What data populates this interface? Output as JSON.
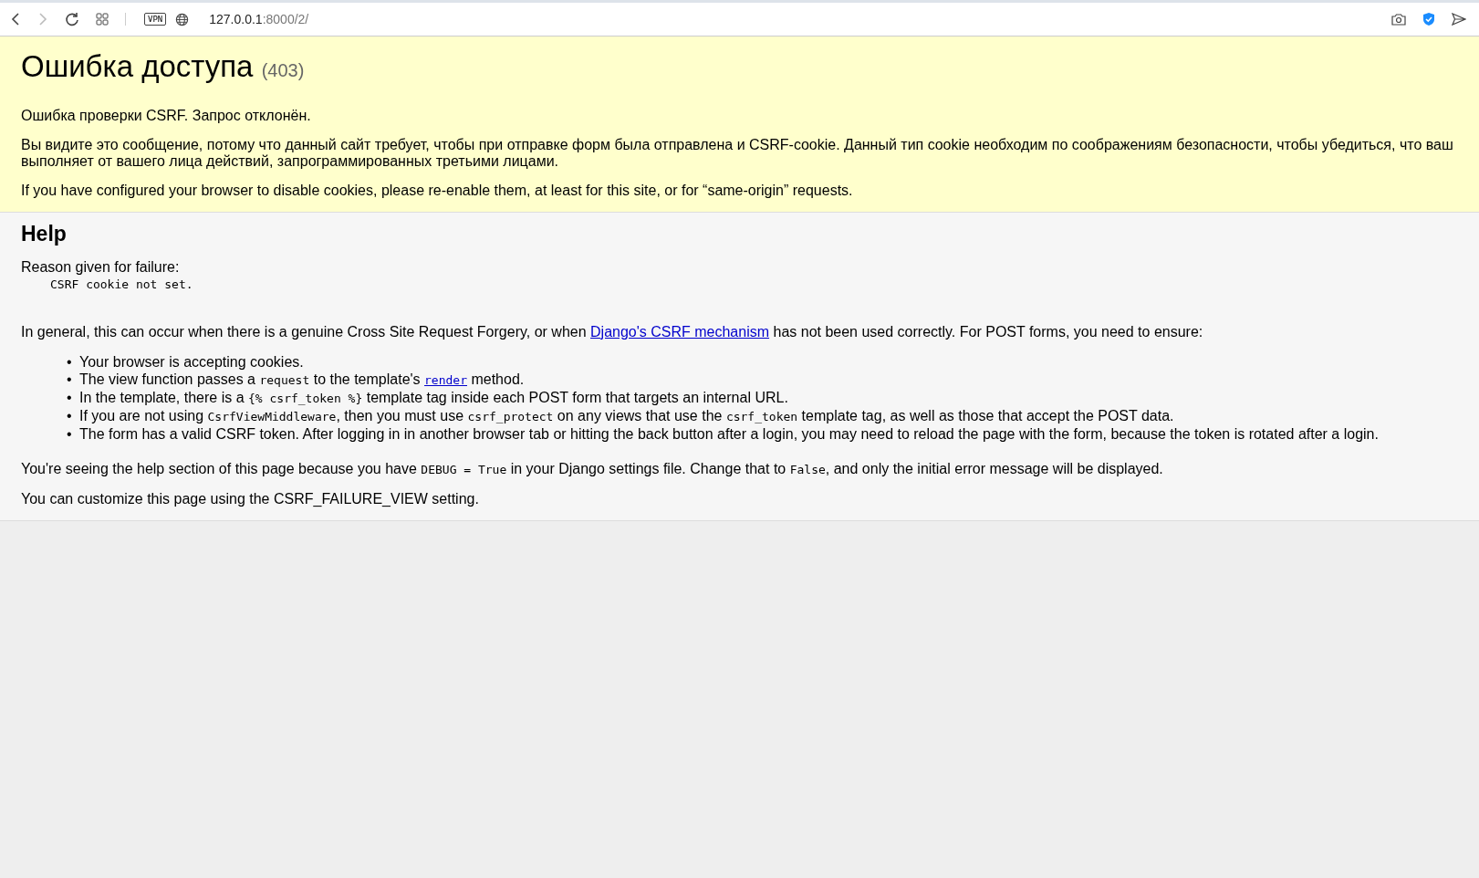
{
  "browser": {
    "url_host": "127.0.0.1",
    "url_rest": ":8000/2/",
    "vpn_badge": "VPN",
    "forward_disabled": true
  },
  "summary": {
    "title": "Ошибка доступа",
    "code": "(403)",
    "message": "Ошибка проверки CSRF. Запрос отклонён.",
    "explanation_lines": [
      "Вы видите это сообщение, потому что данный сайт требует, чтобы при отправке форм была отправлена и CSRF-cookie. Данный тип cookie необходим по соображениям безопасности, чтобы убедиться, что ваш",
      "выполняет от вашего лица действий, запрограммированных третьими лицами."
    ],
    "cookies_note": "If you have configured your browser to disable cookies, please re-enable them, at least for this site, or for “same-origin” requests."
  },
  "help": {
    "heading": "Help",
    "reason_label": "Reason given for failure:",
    "reason": "CSRF cookie not set.",
    "intro": [
      {
        "kind": "text",
        "text": "In general, this can occur when there is a genuine Cross Site Request Forgery, or when "
      },
      {
        "kind": "link",
        "text": "Django's CSRF mechanism"
      },
      {
        "kind": "text",
        "text": " has not been used correctly. For POST forms, you need to ensure:"
      }
    ],
    "items": [
      {
        "bullet": "•",
        "parts": [
          {
            "kind": "text",
            "text": "Your browser is accepting cookies."
          }
        ]
      },
      {
        "bullet": "•",
        "parts": [
          {
            "kind": "text",
            "text": "The view function passes a "
          },
          {
            "kind": "code",
            "text": "request"
          },
          {
            "kind": "text",
            "text": " to the template's "
          },
          {
            "kind": "code_link",
            "text": "render"
          },
          {
            "kind": "text",
            "text": " method."
          }
        ]
      },
      {
        "bullet": "•",
        "parts": [
          {
            "kind": "text",
            "text": "In the template, there is a "
          },
          {
            "kind": "code",
            "text": "{% csrf_token %}"
          },
          {
            "kind": "text",
            "text": " template tag inside each POST form that targets an internal URL."
          }
        ]
      },
      {
        "bullet": "•",
        "parts": [
          {
            "kind": "text",
            "text": "If you are not using "
          },
          {
            "kind": "code",
            "text": "CsrfViewMiddleware"
          },
          {
            "kind": "text",
            "text": ", then you must use "
          },
          {
            "kind": "code",
            "text": "csrf_protect"
          },
          {
            "kind": "text",
            "text": " on any views that use the "
          },
          {
            "kind": "code",
            "text": "csrf_token"
          },
          {
            "kind": "text",
            "text": " template tag, as well as those that accept the POST data."
          }
        ]
      },
      {
        "bullet": "•",
        "parts": [
          {
            "kind": "text",
            "text": "The form has a valid CSRF token. After logging in in another browser tab or hitting the back button after a login, you may need to reload the page with the form, because the token is rotated after a login."
          }
        ]
      }
    ],
    "debug_note": [
      {
        "kind": "text",
        "text": "You're seeing the help section of this page because you have "
      },
      {
        "kind": "code",
        "text": "DEBUG = True"
      },
      {
        "kind": "text",
        "text": " in your Django settings file. Change that to "
      },
      {
        "kind": "code",
        "text": "False"
      },
      {
        "kind": "text",
        "text": ", and only the initial error message will be displayed."
      }
    ],
    "customize_note": "You can customize this page using the CSRF_FAILURE_VIEW setting."
  }
}
